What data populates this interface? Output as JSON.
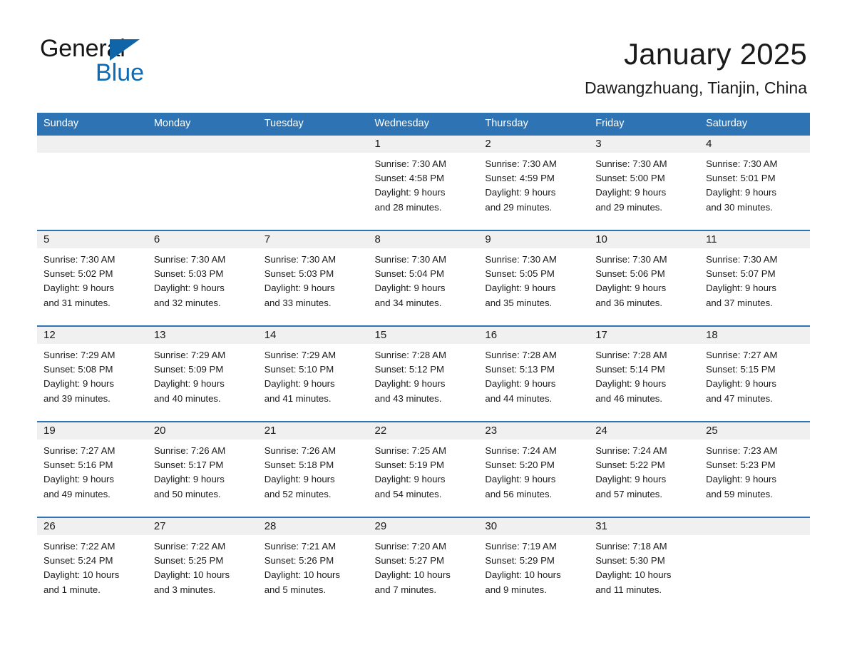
{
  "brand": {
    "name_part1": "General",
    "name_part2": "Blue",
    "logo_triangle_color": "#1065a8",
    "blue_text_color": "#0d6ab4"
  },
  "header": {
    "title": "January 2025",
    "subtitle": "Dawangzhuang, Tianjin, China"
  },
  "theme": {
    "header_blue": "#2e74b5",
    "daynum_band": "#f0f0f0",
    "page_background": "#ffffff"
  },
  "weekdays": [
    "Sunday",
    "Monday",
    "Tuesday",
    "Wednesday",
    "Thursday",
    "Friday",
    "Saturday"
  ],
  "weeks": [
    [
      {
        "day": "",
        "lines": []
      },
      {
        "day": "",
        "lines": []
      },
      {
        "day": "",
        "lines": []
      },
      {
        "day": "1",
        "lines": [
          "Sunrise: 7:30 AM",
          "Sunset: 4:58 PM",
          "Daylight: 9 hours",
          "and 28 minutes."
        ]
      },
      {
        "day": "2",
        "lines": [
          "Sunrise: 7:30 AM",
          "Sunset: 4:59 PM",
          "Daylight: 9 hours",
          "and 29 minutes."
        ]
      },
      {
        "day": "3",
        "lines": [
          "Sunrise: 7:30 AM",
          "Sunset: 5:00 PM",
          "Daylight: 9 hours",
          "and 29 minutes."
        ]
      },
      {
        "day": "4",
        "lines": [
          "Sunrise: 7:30 AM",
          "Sunset: 5:01 PM",
          "Daylight: 9 hours",
          "and 30 minutes."
        ]
      }
    ],
    [
      {
        "day": "5",
        "lines": [
          "Sunrise: 7:30 AM",
          "Sunset: 5:02 PM",
          "Daylight: 9 hours",
          "and 31 minutes."
        ]
      },
      {
        "day": "6",
        "lines": [
          "Sunrise: 7:30 AM",
          "Sunset: 5:03 PM",
          "Daylight: 9 hours",
          "and 32 minutes."
        ]
      },
      {
        "day": "7",
        "lines": [
          "Sunrise: 7:30 AM",
          "Sunset: 5:03 PM",
          "Daylight: 9 hours",
          "and 33 minutes."
        ]
      },
      {
        "day": "8",
        "lines": [
          "Sunrise: 7:30 AM",
          "Sunset: 5:04 PM",
          "Daylight: 9 hours",
          "and 34 minutes."
        ]
      },
      {
        "day": "9",
        "lines": [
          "Sunrise: 7:30 AM",
          "Sunset: 5:05 PM",
          "Daylight: 9 hours",
          "and 35 minutes."
        ]
      },
      {
        "day": "10",
        "lines": [
          "Sunrise: 7:30 AM",
          "Sunset: 5:06 PM",
          "Daylight: 9 hours",
          "and 36 minutes."
        ]
      },
      {
        "day": "11",
        "lines": [
          "Sunrise: 7:30 AM",
          "Sunset: 5:07 PM",
          "Daylight: 9 hours",
          "and 37 minutes."
        ]
      }
    ],
    [
      {
        "day": "12",
        "lines": [
          "Sunrise: 7:29 AM",
          "Sunset: 5:08 PM",
          "Daylight: 9 hours",
          "and 39 minutes."
        ]
      },
      {
        "day": "13",
        "lines": [
          "Sunrise: 7:29 AM",
          "Sunset: 5:09 PM",
          "Daylight: 9 hours",
          "and 40 minutes."
        ]
      },
      {
        "day": "14",
        "lines": [
          "Sunrise: 7:29 AM",
          "Sunset: 5:10 PM",
          "Daylight: 9 hours",
          "and 41 minutes."
        ]
      },
      {
        "day": "15",
        "lines": [
          "Sunrise: 7:28 AM",
          "Sunset: 5:12 PM",
          "Daylight: 9 hours",
          "and 43 minutes."
        ]
      },
      {
        "day": "16",
        "lines": [
          "Sunrise: 7:28 AM",
          "Sunset: 5:13 PM",
          "Daylight: 9 hours",
          "and 44 minutes."
        ]
      },
      {
        "day": "17",
        "lines": [
          "Sunrise: 7:28 AM",
          "Sunset: 5:14 PM",
          "Daylight: 9 hours",
          "and 46 minutes."
        ]
      },
      {
        "day": "18",
        "lines": [
          "Sunrise: 7:27 AM",
          "Sunset: 5:15 PM",
          "Daylight: 9 hours",
          "and 47 minutes."
        ]
      }
    ],
    [
      {
        "day": "19",
        "lines": [
          "Sunrise: 7:27 AM",
          "Sunset: 5:16 PM",
          "Daylight: 9 hours",
          "and 49 minutes."
        ]
      },
      {
        "day": "20",
        "lines": [
          "Sunrise: 7:26 AM",
          "Sunset: 5:17 PM",
          "Daylight: 9 hours",
          "and 50 minutes."
        ]
      },
      {
        "day": "21",
        "lines": [
          "Sunrise: 7:26 AM",
          "Sunset: 5:18 PM",
          "Daylight: 9 hours",
          "and 52 minutes."
        ]
      },
      {
        "day": "22",
        "lines": [
          "Sunrise: 7:25 AM",
          "Sunset: 5:19 PM",
          "Daylight: 9 hours",
          "and 54 minutes."
        ]
      },
      {
        "day": "23",
        "lines": [
          "Sunrise: 7:24 AM",
          "Sunset: 5:20 PM",
          "Daylight: 9 hours",
          "and 56 minutes."
        ]
      },
      {
        "day": "24",
        "lines": [
          "Sunrise: 7:24 AM",
          "Sunset: 5:22 PM",
          "Daylight: 9 hours",
          "and 57 minutes."
        ]
      },
      {
        "day": "25",
        "lines": [
          "Sunrise: 7:23 AM",
          "Sunset: 5:23 PM",
          "Daylight: 9 hours",
          "and 59 minutes."
        ]
      }
    ],
    [
      {
        "day": "26",
        "lines": [
          "Sunrise: 7:22 AM",
          "Sunset: 5:24 PM",
          "Daylight: 10 hours",
          "and 1 minute."
        ]
      },
      {
        "day": "27",
        "lines": [
          "Sunrise: 7:22 AM",
          "Sunset: 5:25 PM",
          "Daylight: 10 hours",
          "and 3 minutes."
        ]
      },
      {
        "day": "28",
        "lines": [
          "Sunrise: 7:21 AM",
          "Sunset: 5:26 PM",
          "Daylight: 10 hours",
          "and 5 minutes."
        ]
      },
      {
        "day": "29",
        "lines": [
          "Sunrise: 7:20 AM",
          "Sunset: 5:27 PM",
          "Daylight: 10 hours",
          "and 7 minutes."
        ]
      },
      {
        "day": "30",
        "lines": [
          "Sunrise: 7:19 AM",
          "Sunset: 5:29 PM",
          "Daylight: 10 hours",
          "and 9 minutes."
        ]
      },
      {
        "day": "31",
        "lines": [
          "Sunrise: 7:18 AM",
          "Sunset: 5:30 PM",
          "Daylight: 10 hours",
          "and 11 minutes."
        ]
      },
      {
        "day": "",
        "lines": []
      }
    ]
  ]
}
